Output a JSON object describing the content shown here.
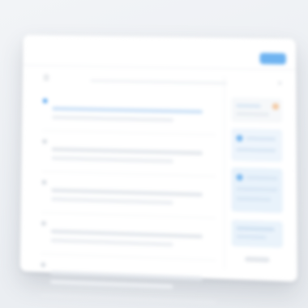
{
  "app": {
    "title": ""
  },
  "toolbar": {
    "primary_label": ""
  },
  "menu": {
    "label": ""
  },
  "list": {
    "items": [
      {
        "title": "",
        "active": true
      },
      {
        "title": "",
        "active": false
      },
      {
        "title": "",
        "active": false
      },
      {
        "title": "",
        "active": false
      },
      {
        "title": "",
        "active": false
      }
    ]
  },
  "panel": {
    "title": ""
  },
  "colors": {
    "accent": "#5aa6ee",
    "accent_light": "#cfe3f7",
    "muted_text": "#aeb5be",
    "highlight": "#f3c9a2",
    "background": "#eceff3"
  },
  "icons": {
    "menu": "hamburger-icon",
    "close": "close-icon",
    "bullet": "dot-icon"
  }
}
